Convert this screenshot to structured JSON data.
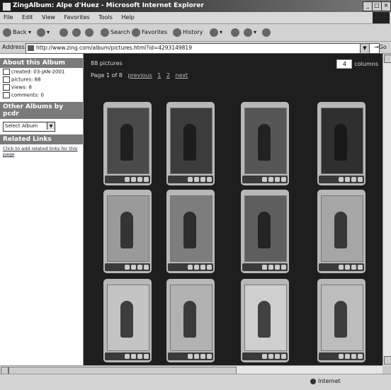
{
  "window": {
    "title": "ZingAlbum: Alpe d'Huez - Microsoft Internet Explorer"
  },
  "menu": [
    "File",
    "Edit",
    "View",
    "Favorites",
    "Tools",
    "Help"
  ],
  "toolbar": {
    "back": "Back",
    "search": "Search",
    "favorites": "Favorites",
    "history": "History"
  },
  "address": {
    "label": "Address",
    "url": "http://www.zing.com/album/pictures.html?id=4293149819",
    "go": "Go"
  },
  "sidebar": {
    "about_title": "About this Album",
    "created": "created: 03-JAN-2001",
    "pictures": "pictures: 88",
    "views": "views: 8",
    "comments": "comments: 0",
    "other_title": "Other Albums by pcdr",
    "select_value": "Select Album",
    "related_title": "Related Links",
    "related_link": "Click to add related links for this page"
  },
  "main": {
    "count": "88 pictures",
    "page_label": "Page 1 of 8",
    "page_links": [
      "previous",
      "1",
      "2",
      "next"
    ],
    "columns_value": "4",
    "columns_label": "columns"
  },
  "status": {
    "zone": "Internet"
  }
}
